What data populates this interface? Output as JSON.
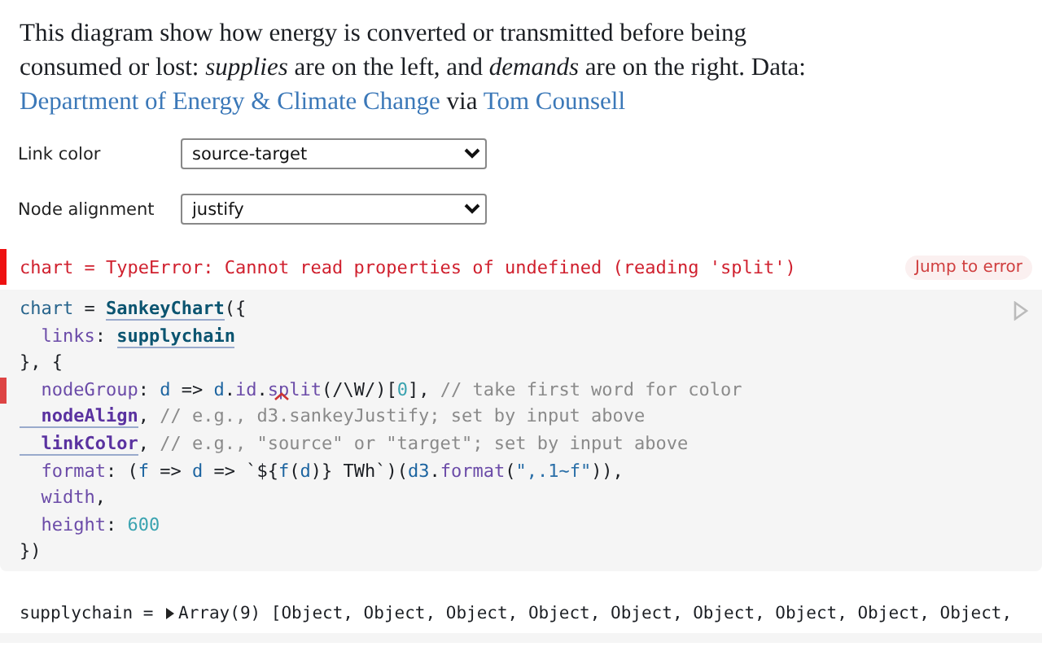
{
  "intro": [
    {
      "kind": "text",
      "t": "This diagram show how energy is converted or transmitted before being consumed or lost: *supplies* are on the left, and *demands* are on the right. Data: "
    },
    {
      "kind": "link",
      "t": "Department of Energy & Climate Change"
    },
    {
      "kind": "text",
      "t": " via "
    },
    {
      "kind": "link",
      "t": "Tom Counsell"
    }
  ],
  "inputs": [
    {
      "label": "Link color",
      "value": "source-target"
    },
    {
      "label": "Node alignment",
      "value": "justify"
    }
  ],
  "error": {
    "message": "chart = TypeError: Cannot read properties of undefined (reading 'split')",
    "button": "Jump to error"
  },
  "code": [
    {
      "error": false,
      "tokens": [
        {
          "kind": "def",
          "t": "chart"
        },
        {
          "kind": "plain",
          "t": " = "
        },
        {
          "kind": "ref",
          "t": "SankeyChart"
        },
        {
          "kind": "plain",
          "t": "({"
        }
      ]
    },
    {
      "error": false,
      "tokens": [
        {
          "kind": "prop",
          "t": "  links"
        },
        {
          "kind": "plain",
          "t": ": "
        },
        {
          "kind": "ref",
          "t": "supplychain"
        }
      ]
    },
    {
      "error": false,
      "tokens": [
        {
          "kind": "plain",
          "t": "}, {"
        }
      ]
    },
    {
      "error": true,
      "tokens": [
        {
          "kind": "prop",
          "t": "  nodeGroup"
        },
        {
          "kind": "plain",
          "t": ": "
        },
        {
          "kind": "param",
          "t": "d"
        },
        {
          "kind": "plain",
          "t": " => "
        },
        {
          "kind": "param",
          "t": "d"
        },
        {
          "kind": "plain",
          "t": "."
        },
        {
          "kind": "prop",
          "t": "id"
        },
        {
          "kind": "plain",
          "t": "."
        },
        {
          "kind": "prop",
          "t": "split",
          "caret": true
        },
        {
          "kind": "plain",
          "t": "(/\\W/)["
        },
        {
          "kind": "number",
          "t": "0"
        },
        {
          "kind": "plain",
          "t": "], "
        },
        {
          "kind": "comment",
          "t": "// take first word for color"
        }
      ]
    },
    {
      "error": false,
      "tokens": [
        {
          "kind": "propref",
          "t": "  nodeAlign"
        },
        {
          "kind": "plain",
          "t": ", "
        },
        {
          "kind": "comment",
          "t": "// e.g., d3.sankeyJustify; set by input above"
        }
      ]
    },
    {
      "error": false,
      "tokens": [
        {
          "kind": "propref",
          "t": "  linkColor"
        },
        {
          "kind": "plain",
          "t": ", "
        },
        {
          "kind": "comment",
          "t": "// e.g., \"source\" or \"target\"; set by input above"
        }
      ]
    },
    {
      "error": false,
      "tokens": [
        {
          "kind": "prop",
          "t": "  format"
        },
        {
          "kind": "plain",
          "t": ": ("
        },
        {
          "kind": "param",
          "t": "f"
        },
        {
          "kind": "plain",
          "t": " => "
        },
        {
          "kind": "param",
          "t": "d"
        },
        {
          "kind": "plain",
          "t": " => `${"
        },
        {
          "kind": "param",
          "t": "f"
        },
        {
          "kind": "plain",
          "t": "("
        },
        {
          "kind": "param",
          "t": "d"
        },
        {
          "kind": "plain",
          "t": ")} TWh`)("
        },
        {
          "kind": "param",
          "t": "d3"
        },
        {
          "kind": "plain",
          "t": "."
        },
        {
          "kind": "prop",
          "t": "format"
        },
        {
          "kind": "plain",
          "t": "("
        },
        {
          "kind": "string",
          "t": "\",.1~f\""
        },
        {
          "kind": "plain",
          "t": ")),"
        }
      ]
    },
    {
      "error": false,
      "tokens": [
        {
          "kind": "prop",
          "t": "  width"
        },
        {
          "kind": "plain",
          "t": ","
        }
      ]
    },
    {
      "error": false,
      "tokens": [
        {
          "kind": "prop",
          "t": "  height"
        },
        {
          "kind": "plain",
          "t": ": "
        },
        {
          "kind": "number",
          "t": "600"
        }
      ]
    },
    {
      "error": false,
      "tokens": [
        {
          "kind": "plain",
          "t": "})"
        }
      ]
    }
  ],
  "output": {
    "name": "supplychain = ",
    "value": "Array(9) [Object, Object, Object, Object, Object, Object, Object, Object, Object,"
  }
}
